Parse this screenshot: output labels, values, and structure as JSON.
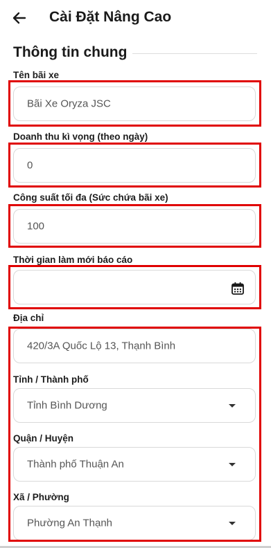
{
  "header": {
    "title": "Cài Đặt Nâng Cao",
    "back_icon": "arrow-left-icon"
  },
  "section": {
    "title": "Thông tin chung"
  },
  "fields": {
    "parking_name": {
      "label": "Tên bãi xe",
      "value": "Bãi Xe Oryza JSC"
    },
    "expected_revenue": {
      "label": "Doanh thu kì vọng (theo ngày)",
      "value": "0"
    },
    "max_capacity": {
      "label": "Công suất tối đa (Sức chứa bãi xe)",
      "value": "100"
    },
    "report_refresh": {
      "label": "Thời gian làm mới báo cáo",
      "value": "",
      "icon": "calendar-icon"
    },
    "address": {
      "label": "Địa chỉ",
      "value": "420/3A Quốc Lộ 13, Thạnh Bình"
    },
    "province": {
      "label": "Tỉnh / Thành phố",
      "value": "Tỉnh Bình Dương"
    },
    "district": {
      "label": "Quận / Huyện",
      "value": "Thành phố Thuận An"
    },
    "ward": {
      "label": "Xã / Phường",
      "value": "Phường An Thạnh"
    }
  },
  "colors": {
    "highlight": "#e00000",
    "border": "#d9d9d9"
  }
}
